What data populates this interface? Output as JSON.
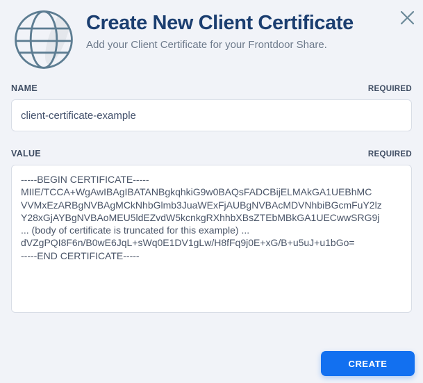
{
  "modal": {
    "title": "Create New Client Certificate",
    "subtitle": "Add your Client Certificate for your Frontdoor Share."
  },
  "icons": {
    "globe": "globe-icon",
    "close": "close-icon"
  },
  "fields": {
    "name": {
      "label": "NAME",
      "required": "REQUIRED",
      "value": "client-certificate-example"
    },
    "value": {
      "label": "VALUE",
      "required": "REQUIRED",
      "value": "-----BEGIN CERTIFICATE-----\nMIIE/TCCA+WgAwIBAgIBATANBgkqhkiG9w0BAQsFADCBijELMAkGA1UEBhMC\nVVMxEzARBgNVBAgMCkNhbGlmb3JuaWExFjAUBgNVBAcMDVNhbiBGcmFuY2lz\nY28xGjAYBgNVBAoMEU5ldEZvdW5kcnkgRXhhbXBsZTEbMBkGA1UECwwSRG9j\n... (body of certificate is truncated for this example) ...\ndVZgPQI8F6n/B0wE6JqL+sWq0E1DV1gLw/H8fFq9j0E+xG/B+u5uJ+u1bGo=\n-----END CERTIFICATE-----"
    }
  },
  "actions": {
    "create_label": "CREATE"
  },
  "colors": {
    "accent": "#1270f0",
    "title": "#1b3e70",
    "background": "#f1f3f8",
    "input_border": "#d8dde6",
    "icon_stroke": "#5d7d92"
  }
}
